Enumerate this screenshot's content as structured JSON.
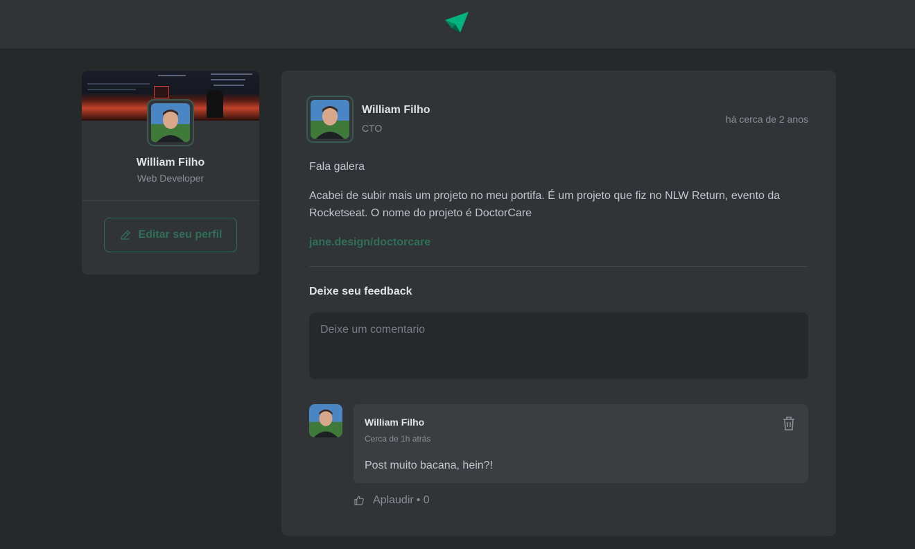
{
  "header": {
    "logo_icon": "paper-plane-logo-icon",
    "brand_color": "#00875f"
  },
  "sidebar": {
    "name": "William Filho",
    "role": "Web Developer",
    "edit_button_label": "Editar seu perfil",
    "edit_icon": "pencil-icon"
  },
  "post": {
    "author_name": "William Filho",
    "author_role": "CTO",
    "time": "há cerca de 2 anos",
    "paragraphs": [
      "Fala galera",
      "Acabei de subir mais um projeto no meu portifa. É um projeto que fiz no NLW Return, evento da Rocketseat. O nome do projeto é DoctorCare"
    ],
    "link": "jane.design/doctorcare",
    "feedback_title": "Deixe seu feedback",
    "comment_placeholder": "Deixe um comentario"
  },
  "comment": {
    "author_name": "William Filho",
    "time": "Cerca de 1h atrás",
    "text": "Post muito bacana, hein?!",
    "delete_icon": "trash-icon",
    "applaud_icon": "thumbs-up-icon",
    "applaud_label": "Aplaudir",
    "applaud_count": "• 0"
  }
}
